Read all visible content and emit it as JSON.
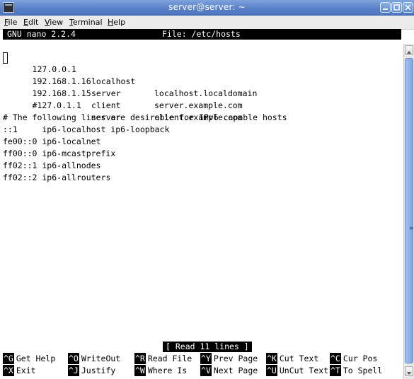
{
  "window": {
    "title": "server@server: ~",
    "icon": "terminal-icon",
    "controls": [
      "minimize-icon",
      "maximize-icon",
      "close-icon"
    ]
  },
  "menubar": {
    "items": [
      {
        "label": "File",
        "mnemonic": "F",
        "rest": "ile"
      },
      {
        "label": "Edit",
        "mnemonic": "E",
        "rest": "dit"
      },
      {
        "label": "View",
        "mnemonic": "V",
        "rest": "iew"
      },
      {
        "label": "Terminal",
        "mnemonic": "T",
        "rest": "erminal"
      },
      {
        "label": "Help",
        "mnemonic": "H",
        "rest": "elp"
      }
    ]
  },
  "nano": {
    "version": "GNU nano 2.2.4",
    "file_label": "File: /etc/hosts",
    "status": "[ Read 11 lines ]",
    "lines": [
      {
        "a": "127.0.0.1",
        "b": "localhost",
        "c": "localhost.localdomain"
      },
      {
        "a": "192.168.1.16",
        "b": "server",
        "c": "server.example.com"
      },
      {
        "a": "192.168.1.15",
        "b": "client",
        "c": "client.example.com"
      },
      {
        "a": "#127.0.1.1",
        "b": "server",
        "c": ""
      },
      {
        "text": ""
      },
      {
        "text": "# The following lines are desirable for IPv6 capable hosts"
      },
      {
        "text": "::1     ip6-localhost ip6-loopback"
      },
      {
        "text": "fe00::0 ip6-localnet"
      },
      {
        "text": "ff00::0 ip6-mcastprefix"
      },
      {
        "text": "ff02::1 ip6-allnodes"
      },
      {
        "text": "ff02::2 ip6-allrouters"
      }
    ],
    "shortcuts_row1": [
      {
        "key": "^G",
        "label": "Get Help"
      },
      {
        "key": "^O",
        "label": "WriteOut"
      },
      {
        "key": "^R",
        "label": "Read File"
      },
      {
        "key": "^Y",
        "label": "Prev Page"
      },
      {
        "key": "^K",
        "label": "Cut Text"
      },
      {
        "key": "^C",
        "label": "Cur Pos"
      }
    ],
    "shortcuts_row2": [
      {
        "key": "^X",
        "label": "Exit"
      },
      {
        "key": "^J",
        "label": "Justify"
      },
      {
        "key": "^W",
        "label": "Where Is"
      },
      {
        "key": "^V",
        "label": "Next Page"
      },
      {
        "key": "^U",
        "label": "UnCut Text"
      },
      {
        "key": "^T",
        "label": "To Spell"
      }
    ]
  },
  "scrollbar": {
    "icons": [
      "scroll-up-icon",
      "scroll-down-icon",
      "grip-icon"
    ]
  },
  "colors": {
    "titlebar": "#5b82c9",
    "terminal_bg": "#ffffff",
    "terminal_fg": "#000000",
    "inverse_bg": "#000000"
  }
}
